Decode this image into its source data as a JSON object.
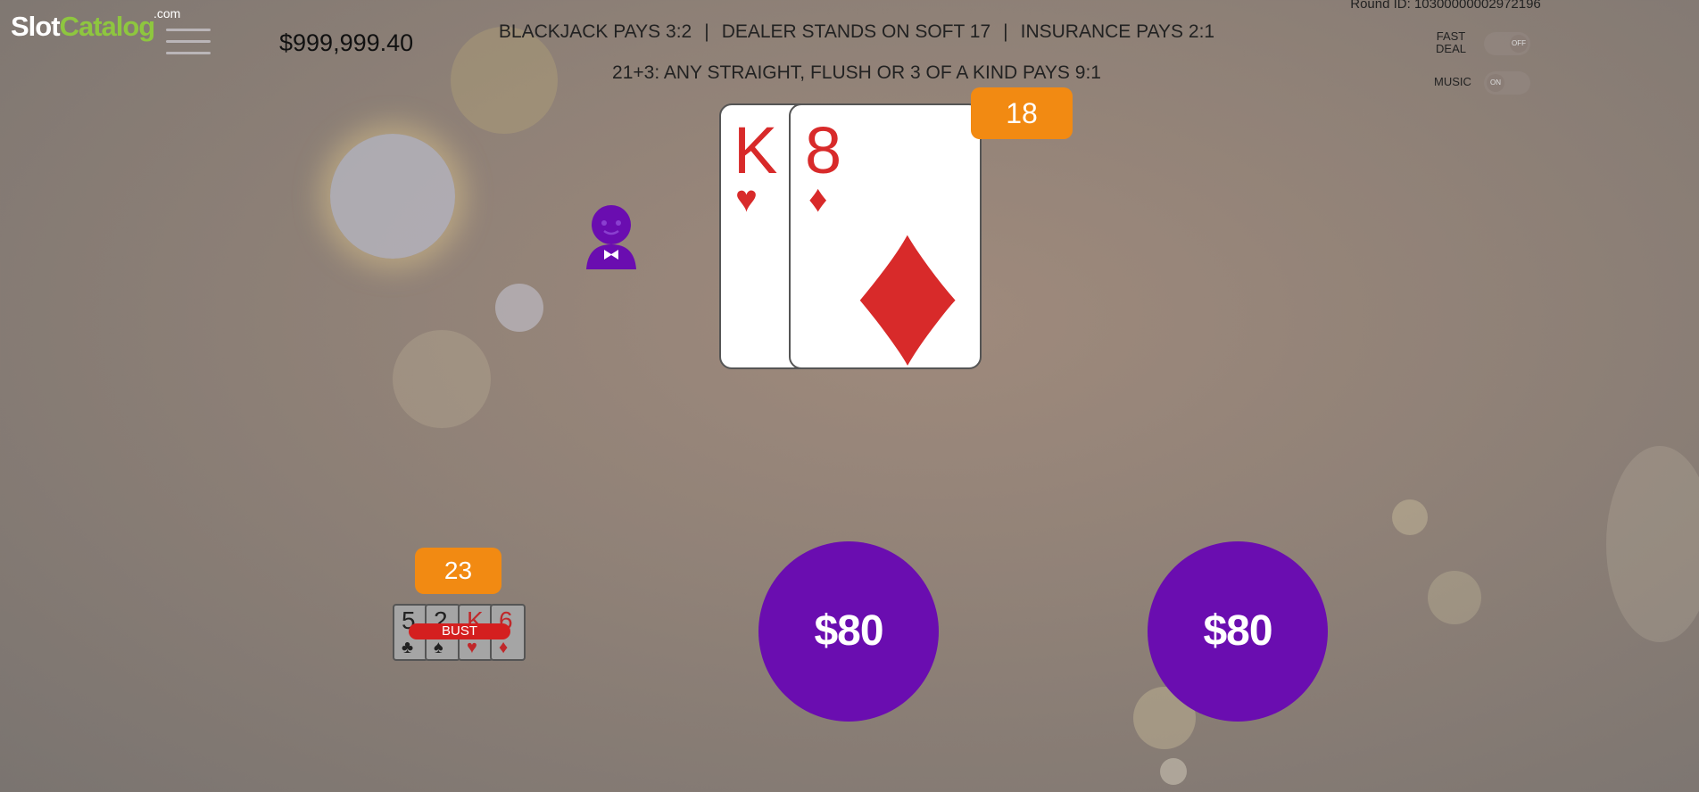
{
  "logo": {
    "part1": "Slot",
    "part2": "Catalog",
    "suffix": ".com"
  },
  "balance": "$999,999.40",
  "rules": {
    "blackjack": "BLACKJACK PAYS 3:2",
    "dealer": "DEALER STANDS ON SOFT 17",
    "insurance": "INSURANCE PAYS 2:1",
    "side_bet": "21+3: ANY STRAIGHT, FLUSH OR 3 OF A KIND PAYS 9:1",
    "separator": "|"
  },
  "round_id": "Round ID: 10300000002972196",
  "options": {
    "fast_deal": {
      "label_line1": "FAST",
      "label_line2": "DEAL",
      "state": "OFF"
    },
    "music": {
      "label": "MUSIC",
      "state": "ON"
    }
  },
  "dealer_hand": {
    "score": "18",
    "cards": [
      {
        "rank": "K",
        "suit": "♥",
        "color": "#d82a2a"
      },
      {
        "rank": "8",
        "suit": "♦",
        "color": "#d82a2a"
      }
    ]
  },
  "player_hand": {
    "score": "23",
    "status": "BUST",
    "cards": [
      {
        "rank": "5",
        "suit": "♣",
        "color": "#222222"
      },
      {
        "rank": "2",
        "suit": "♠",
        "color": "#222222"
      },
      {
        "rank": "K",
        "suit": "♥",
        "color": "#d82a2a"
      },
      {
        "rank": "6",
        "suit": "♦",
        "color": "#d82a2a"
      }
    ]
  },
  "bet_spots": [
    {
      "amount": "$80"
    },
    {
      "amount": "$80"
    }
  ],
  "icons": {
    "menu": "hamburger-menu-icon",
    "dealer": "dealer-avatar-icon"
  },
  "colors": {
    "chip": "#6a0db0",
    "score_badge": "#f28a12",
    "bust": "#d41f1f",
    "logo_green": "#8ec63f"
  }
}
